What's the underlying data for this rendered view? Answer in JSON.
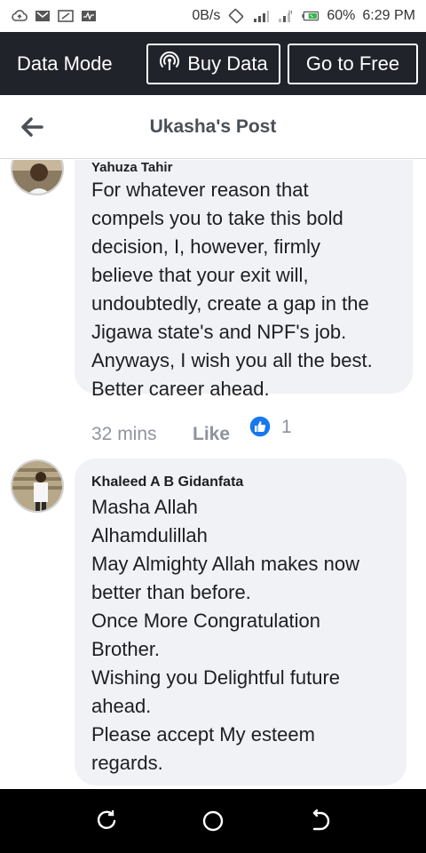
{
  "status_bar": {
    "net_speed": "0B/s",
    "battery": "60%",
    "time": "6:29 PM",
    "icons": [
      "cloud-upload-icon",
      "gmail-icon",
      "screenshot-icon",
      "activity-icon",
      "rotate-icon",
      "signal-icon",
      "signal-h-icon",
      "battery-icon"
    ]
  },
  "data_bar": {
    "mode_label": "Data Mode",
    "buy_label": "Buy Data",
    "free_label": "Go to Free"
  },
  "header": {
    "title": "Ukasha's Post"
  },
  "comments": [
    {
      "author": "Yahuza Tahir",
      "lines": [
        "For whatever reason that",
        "compels you to take this bold",
        "decision, I, however, firmly",
        "believe that your exit will,",
        "undoubtedly, create a gap in the",
        "Jigawa state's and NPF's job.",
        "Anyways, I wish you all the best.",
        "Better career ahead."
      ],
      "time": "32 mins",
      "like_label": "Like",
      "reaction_count": "1"
    },
    {
      "author": "Khaleed A B Gidanfata",
      "lines": [
        "Masha Allah",
        "Alhamdulillah",
        "May Almighty Allah makes now",
        "better than before.",
        "Once More Congratulation",
        "Brother.",
        "Wishing you Delightful future",
        "ahead.",
        "Please accept My esteem",
        "regards."
      ]
    }
  ],
  "colors": {
    "data_bar_bg": "#20232a",
    "bubble_bg": "#f0f2f5",
    "like_blue": "#1877f2"
  }
}
